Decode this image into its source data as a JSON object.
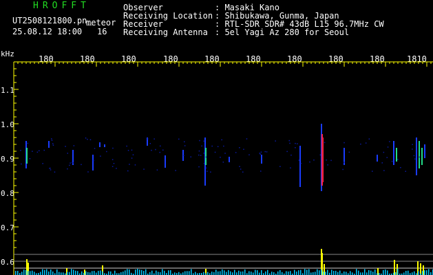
{
  "header": {
    "app_title": "HROFFT",
    "file_name": "UT2508121800.pn_",
    "meteor_label": "meteor",
    "datetime": "25.08.12 18:00",
    "meteor_count": "16"
  },
  "meta": [
    {
      "label": "Observer",
      "value": ": Masaki Kano"
    },
    {
      "label": "Receiving Location",
      "value": ": Shibukawa, Gunma, Japan"
    },
    {
      "label": "Receiver",
      "value": ": RTL-SDR SDR# 43dB L15 96.7MHz CW"
    },
    {
      "label": "Receiving Antenna",
      "value": ": 5el Yagi Az 280 for Seoul"
    }
  ],
  "axes": {
    "unit": "kHz",
    "x_ticks": [
      "180",
      "180",
      "180",
      "180",
      "180",
      "180",
      "180",
      "180",
      "180",
      "1810"
    ],
    "y_ticks": [
      "1.1",
      "1.0",
      "0.9",
      "0.8",
      "0.7",
      "0.6"
    ]
  },
  "colors": {
    "background": "#000000",
    "text": "#ffffff",
    "title": "#22dd22",
    "axis": "#ffff00",
    "signal_low": "#1a3cff",
    "signal_mid": "#22dd88",
    "signal_high": "#ff2244",
    "level_bars": "#ffff00",
    "noise_floor": "#00c8ff",
    "guide_lines": "#888888"
  }
}
